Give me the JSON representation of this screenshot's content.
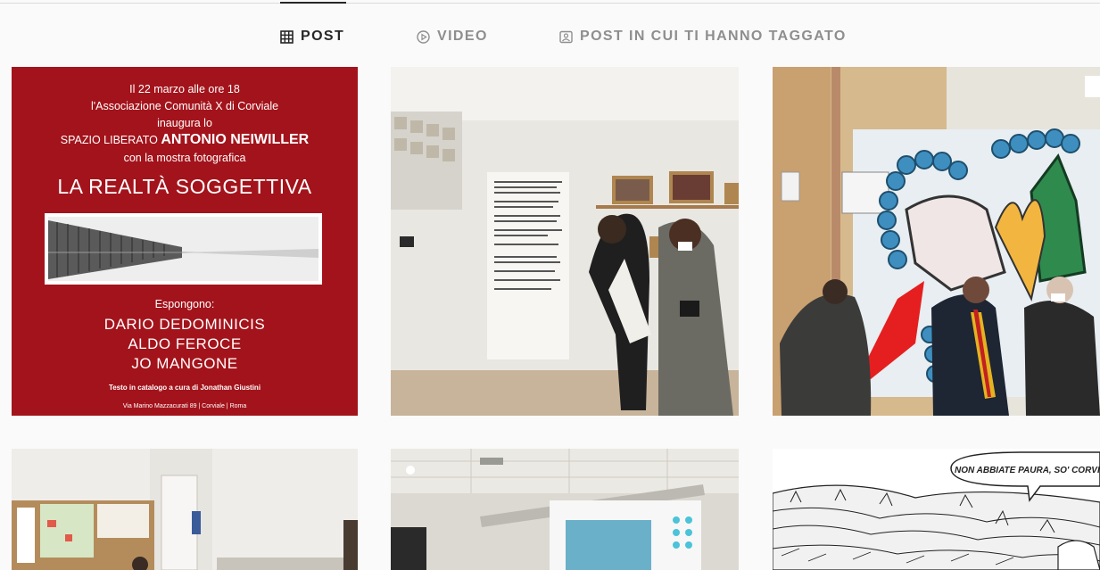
{
  "tabs": [
    {
      "label": "POST",
      "icon": "grid-icon",
      "active": true
    },
    {
      "label": "VIDEO",
      "icon": "play-circle-icon",
      "active": false
    },
    {
      "label": "POST IN CUI TI HANNO TAGGATO",
      "icon": "tagged-user-icon",
      "active": false
    }
  ],
  "poster": {
    "line1": "Il 22 marzo alle ore 18",
    "line2": "l'Associazione Comunità X di Corviale",
    "line3": "inaugura lo",
    "line4_small": "SPAZIO LIBERATO",
    "line4_big": "ANTONIO NEIWILLER",
    "line5": "con la mostra fotografica",
    "title": "LA REALTÀ SOGGETTIVA",
    "exhibit_label": "Espongono:",
    "artists": [
      "DARIO DEDOMINICIS",
      "ALDO FEROCE",
      "JO MANGONE"
    ],
    "catalog": "Testo in catalogo a cura di Jonathan Giustini",
    "address": "Via Marino Mazzacurati 89 | Corviale | Roma"
  },
  "comic": {
    "speech": "NON ABBIATE PAURA, SO' CORVI"
  },
  "colors": {
    "poster_red": "#a3131b",
    "active_tab": "#262626",
    "inactive_tab": "#8e8e8e"
  }
}
